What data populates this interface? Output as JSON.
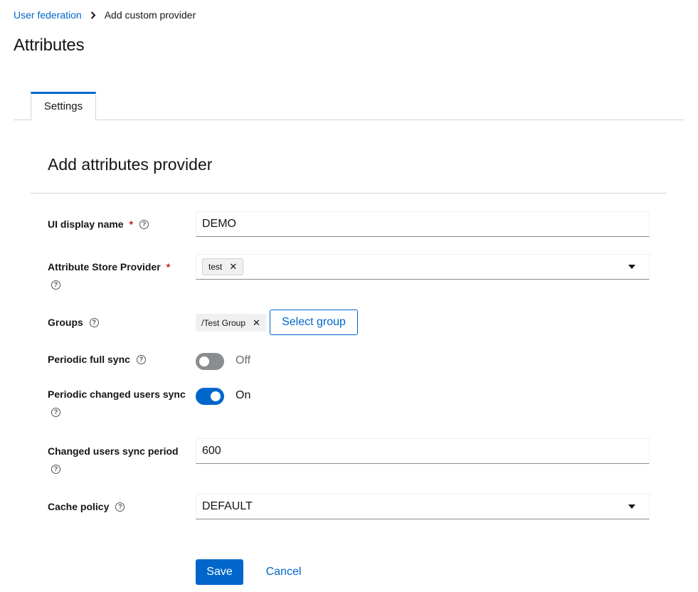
{
  "breadcrumb": {
    "parent": "User federation",
    "current": "Add custom provider"
  },
  "page_title": "Attributes",
  "tabs": [
    {
      "label": "Settings",
      "active": true
    }
  ],
  "section_title": "Add attributes provider",
  "form": {
    "display_name": {
      "label": "UI display name",
      "required": true,
      "value": "DEMO"
    },
    "attribute_store_provider": {
      "label": "Attribute Store Provider",
      "required": true,
      "chips": [
        "test"
      ]
    },
    "groups": {
      "label": "Groups",
      "chips": [
        "/Test Group"
      ],
      "select_button": "Select group"
    },
    "periodic_full_sync": {
      "label": "Periodic full sync",
      "state": false,
      "state_label": "Off"
    },
    "periodic_changed_users_sync": {
      "label": "Periodic changed users sync",
      "state": true,
      "state_label": "On"
    },
    "changed_users_sync_period": {
      "label": "Changed users sync period",
      "value": "600"
    },
    "cache_policy": {
      "label": "Cache policy",
      "value": "DEFAULT"
    }
  },
  "actions": {
    "save": "Save",
    "cancel": "Cancel"
  },
  "icons": {
    "help": "help-circle-icon",
    "remove_chip": "close-icon",
    "caret": "caret-down-icon",
    "breadcrumb_sep": "chevron-right-icon"
  },
  "colors": {
    "accent": "#0066cc",
    "required": "#c9190b",
    "switch_off": "#8a8d90"
  }
}
